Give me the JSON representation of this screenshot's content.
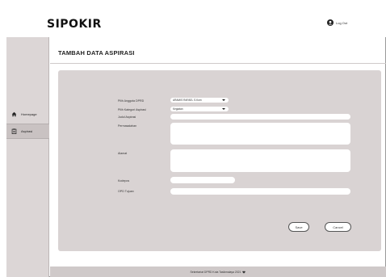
{
  "header": {
    "brand": "SIPOKIR",
    "logout_label": "Log Out"
  },
  "sidebar": {
    "items": [
      {
        "label": "Homepage",
        "icon": "home-icon"
      },
      {
        "label": "Aspirasi",
        "icon": "clipboard-icon",
        "active": true
      }
    ]
  },
  "page": {
    "title": "TAMBAH DATA ASPIRASI"
  },
  "form": {
    "anggota_label": "Pilih Anggota DPRD",
    "anggota_value": "ARAMIS RAFAEL S.Kom",
    "kategori_label": "Pilih Kategori Aspirasi",
    "kategori_value": "Kegiatan",
    "judul_label": "Judul Aspirasi",
    "permasalahan_label": "Permasalahan",
    "alamat_label": "Alamat",
    "kodepos_label": "Kodepos",
    "opd_label": "OPD Tujuan",
    "save_label": "Save",
    "cancel_label": "Cancel"
  },
  "footer": {
    "text": "Sekretariat DPRD Kota Tasikmalaya 2021"
  },
  "colors": {
    "sidebar": "#dcd6d6",
    "card": "#d9d3d3",
    "footer": "#cfc9c9"
  }
}
